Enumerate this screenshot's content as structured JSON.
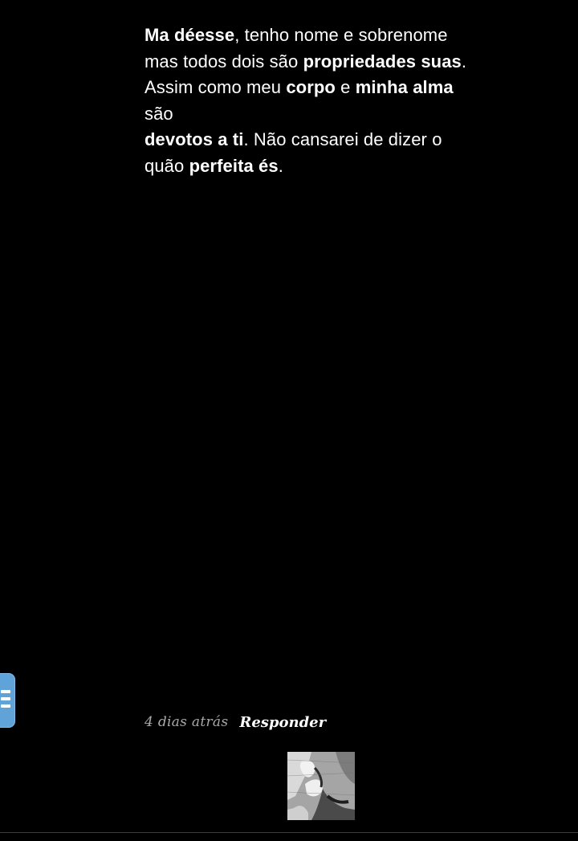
{
  "comment": {
    "lines": [
      [
        {
          "t": "Ma déesse",
          "b": true
        },
        {
          "t": ", tenho nome e sobrenome",
          "b": false
        }
      ],
      [
        {
          "t": "mas todos dois são ",
          "b": false
        },
        {
          "t": "propriedades suas",
          "b": true
        },
        {
          "t": ".",
          "b": false
        }
      ],
      [
        {
          "t": "Assim como meu ",
          "b": false
        },
        {
          "t": "corpo",
          "b": true
        },
        {
          "t": " e ",
          "b": false
        },
        {
          "t": "minha alma",
          "b": true
        }
      ],
      [
        {
          "t": "são",
          "b": false
        }
      ],
      [
        {
          "t": "devotos a ti",
          "b": true
        },
        {
          "t": ". Não cansarei de dizer o",
          "b": false
        }
      ],
      [
        {
          "t": "quão ",
          "b": false
        },
        {
          "t": "perfeita és",
          "b": true
        },
        {
          "t": ".",
          "b": false
        }
      ]
    ]
  },
  "meta": {
    "timestamp": "4 dias atrás",
    "reply_label": "Responder"
  },
  "side_tab": {
    "icon": "menu-lines-icon",
    "color": "#5fa3d9"
  },
  "avatar": {
    "icon": "user-avatar-image"
  },
  "colors": {
    "background": "#000000",
    "text": "#ffffff",
    "timestamp": "#a9a9a9"
  }
}
